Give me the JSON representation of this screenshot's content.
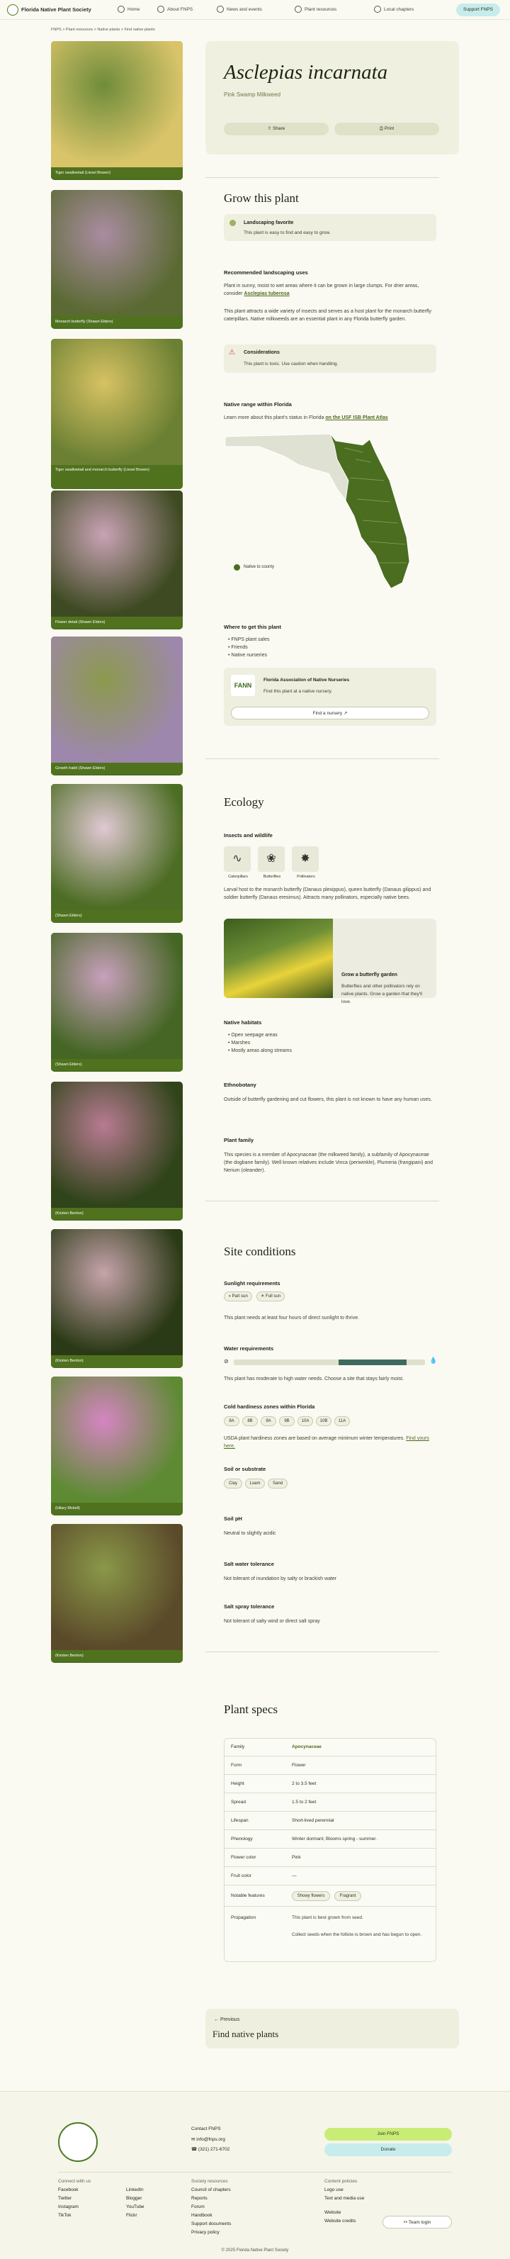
{
  "header": {
    "site": "Florida Native Plant Society",
    "nav": [
      "Home",
      "About FNPS",
      "News and events",
      "Plant resources",
      "Local chapters"
    ],
    "support": "Support FNPS"
  },
  "breadcrumb": "FNPS  >  Plant resources  >  Native plants  >  Find native plants",
  "photos": [
    {
      "caption": "Tiger swallowtail (Liesel Bowen)",
      "c1": "#6f8c3a",
      "c2": "#d9c46a"
    },
    {
      "caption": "Monarch butterfly (Shawn Elders)",
      "c1": "#a98ca1",
      "c2": "#5b6a33"
    },
    {
      "caption": "Tiger swallowtail and monarch butterfly (Liesel Bowen)",
      "c1": "#d7c263",
      "c2": "#6b8033"
    },
    {
      "caption": "Flower detail (Shawn Elders)",
      "c1": "#c9a3b5",
      "c2": "#3e4a22"
    },
    {
      "caption": "Growth habit (Shawn Elders)",
      "c1": "#8c9a4e",
      "c2": "#9d87ac"
    },
    {
      "caption": "(Shawn Elders)",
      "c1": "#e0c8d3",
      "c2": "#4d6d24"
    },
    {
      "caption": "(Shawn Elders)",
      "c1": "#c8a0bc",
      "c2": "#456624"
    },
    {
      "caption": "(Kirsten Benton)",
      "c1": "#b87b92",
      "c2": "#2f4419"
    },
    {
      "caption": "(Kirsten Benton)",
      "c1": "#c6a3aa",
      "c2": "#2b3a16"
    },
    {
      "caption": "(Hilary Mckell)",
      "c1": "#d585c2",
      "c2": "#5d8a32"
    },
    {
      "caption": "(Kirsten Benton)",
      "c1": "#8a9848",
      "c2": "#5b4a2a"
    }
  ],
  "plant": {
    "name": "Asclepias incarnata",
    "common": "Pink Swamp Milkweed",
    "share": "Share",
    "print": "Print"
  },
  "grow": {
    "title": "Grow this plant",
    "fav_title": "Landscaping favorite",
    "fav_text": "This plant is easy to find and easy to grow.",
    "uses_title": "Recommended landscaping uses",
    "uses_text1": "Plant in sunny, moist to wet areas where it can be grown in large clumps. For drier areas, consider",
    "uses_link": "Asclepias tuberosa",
    "uses_text2": "This plant attracts a wide variety of insects and serves as a host plant for the monarch butterfly caterpillars. Native milkweeds are an essential plant in any Florida butterfly garden.",
    "cons_title": "Considerations",
    "cons_text": "This plant is toxic. Use caution when handling.",
    "range_title": "Native range within Florida",
    "range_text": "Learn more about this plant's status in Florida",
    "range_link": "on the USF ISB Plant Atlas",
    "legend": "Native to county",
    "get_title": "Where to get this plant",
    "get_list": [
      "FNPS plant sales",
      "Friends",
      "Native nurseries"
    ],
    "fann_title": "Florida Association of Native Nurseries",
    "fann_text": "Find this plant at a native nursery.",
    "fann_logo": "FANN",
    "fann_btn": "Find a nursery"
  },
  "ecology": {
    "title": "Ecology",
    "wild_title": "Insects and wildlife",
    "icons": [
      "Caterpillars",
      "Butterflies",
      "Pollinators"
    ],
    "wild_text": "Larval host to the monarch butterfly (Danaus plexippus), queen butterfly (Danaus gilippus) and soldier butterfly (Danaus eresimus). Attracts many pollinators, especially native bees.",
    "garden_title": "Grow a butterfly garden",
    "garden_text": "Butterflies and other pollinators rely on native plants. Grow a garden that they'll love.",
    "garden_btn": "Learn more",
    "hab_title": "Native habitats",
    "hab_list": [
      "Open seepage areas",
      "Marshes",
      "Mostly areas along streams"
    ],
    "eth_title": "Ethnobotany",
    "eth_text": "Outside of butterfly gardening and cut flowers, this plant is not known to have any human uses.",
    "fam_title": "Plant family",
    "fam_text": "This species is a member of Apocynaceae (the milkweed family), a subfamily of Apocynaceae (the dogbane family). Well known relatives include Vinca (periwinkle), Plumeria (frangipani) and Nerium (oleander)."
  },
  "site": {
    "title": "Site conditions",
    "sun_title": "Sunlight requirements",
    "sun": [
      "Part sun",
      "Full sun"
    ],
    "sun_text": "This plant needs at least four hours of direct sunlight to thrive.",
    "water_title": "Water requirements",
    "water_text": "This plant has moderate to high water needs. Choose a site that stays fairly moist.",
    "zone_title": "Cold hardiness zones within Florida",
    "zones": [
      "8A",
      "8B",
      "9A",
      "9B",
      "10A",
      "10B",
      "11A"
    ],
    "zone_text": "USDA plant hardiness zones are based on average minimum winter temperatures.",
    "zone_link": "Find yours here.",
    "soil_title": "Soil or substrate",
    "soil": [
      "Clay",
      "Loam",
      "Sand"
    ],
    "ph_title": "Soil pH",
    "ph_text": "Neutral to slightly acidic",
    "salt_title": "Salt water tolerance",
    "salt_text": "Not tolerant of inundation by salty or brackish water",
    "spray_title": "Salt spray tolerance",
    "spray_text": "Not tolerant of salty wind or direct salt spray"
  },
  "specs": {
    "title": "Plant specs",
    "rows": [
      [
        "Family",
        "Apocynaceae"
      ],
      [
        "Form",
        "Flower"
      ],
      [
        "Height",
        "2 to 3.5 feet"
      ],
      [
        "Spread",
        "1.5 to 2 feet"
      ],
      [
        "Lifespan",
        "Short-lived perennial"
      ],
      [
        "Phenology",
        "Winter dormant; Blooms spring - summer."
      ],
      [
        "Flower color",
        "Pink"
      ],
      [
        "Fruit color",
        "—"
      ]
    ],
    "notable_label": "Notable features",
    "notable": [
      "Showy flowers",
      "Fragrant"
    ],
    "prop_label": "Propagation",
    "prop1": "This plant is best grown from seed.",
    "prop2": "Collect seeds when the follicle is brown and has begun to open."
  },
  "prev": {
    "label": "Previous",
    "title": "Find native plants"
  },
  "footer": {
    "contact": "Contact FNPS",
    "email": "info@fnps.org",
    "phone": "(321) 271-6702",
    "join": "Join FNPS",
    "donate": "Donate",
    "col1_title": "Connect with us",
    "col1": [
      "Facebook",
      "Twitter",
      "Instagram",
      "TikTok"
    ],
    "col2": [
      "LinkedIn",
      "Blogger",
      "YouTube",
      "Flickr"
    ],
    "col3_title": "Society resources",
    "col3": [
      "Council of chapters",
      "Reports",
      "Forum",
      "Handbook",
      "Support documents",
      "Privacy policy"
    ],
    "col4_title": "Content policies",
    "col4": [
      "Logo use",
      "Text and media use"
    ],
    "web_title": "Website",
    "web": "Website credits",
    "signin": "Team login",
    "copy": "© 2025 Florida Native Plant Society"
  }
}
